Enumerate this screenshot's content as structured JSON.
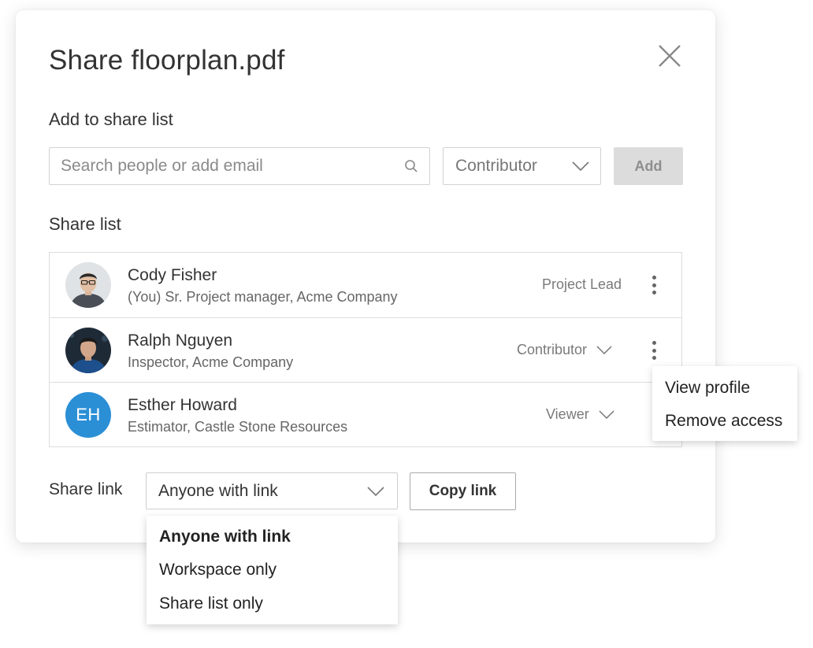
{
  "dialog": {
    "title": "Share floorplan.pdf",
    "close_icon": "close-icon"
  },
  "add_section": {
    "heading": "Add to share list",
    "search_placeholder": "Search people or add email",
    "search_icon": "search-icon",
    "role_value": "Contributor",
    "add_label": "Add"
  },
  "share_list": {
    "heading": "Share list",
    "people": [
      {
        "name": "Cody Fisher",
        "description": "(You) Sr. Project manager, Acme Company",
        "role": "Project Lead",
        "avatar": "photo"
      },
      {
        "name": "Ralph Nguyen",
        "description": "Inspector, Acme Company",
        "role": "Contributor",
        "avatar": "photo"
      },
      {
        "name": "Esther Howard",
        "description": "Estimator, Castle Stone Resources",
        "role": "Viewer",
        "avatar": "initials",
        "initials": "EH",
        "avatar_color": "#2b8fd6"
      }
    ]
  },
  "person_menu": {
    "items": [
      "View profile",
      "Remove access"
    ]
  },
  "share_link": {
    "label": "Share link",
    "value": "Anyone with link",
    "copy_label": "Copy link",
    "options": [
      "Anyone with link",
      "Workspace only",
      "Share list only"
    ],
    "selected_option": "Anyone with link"
  }
}
